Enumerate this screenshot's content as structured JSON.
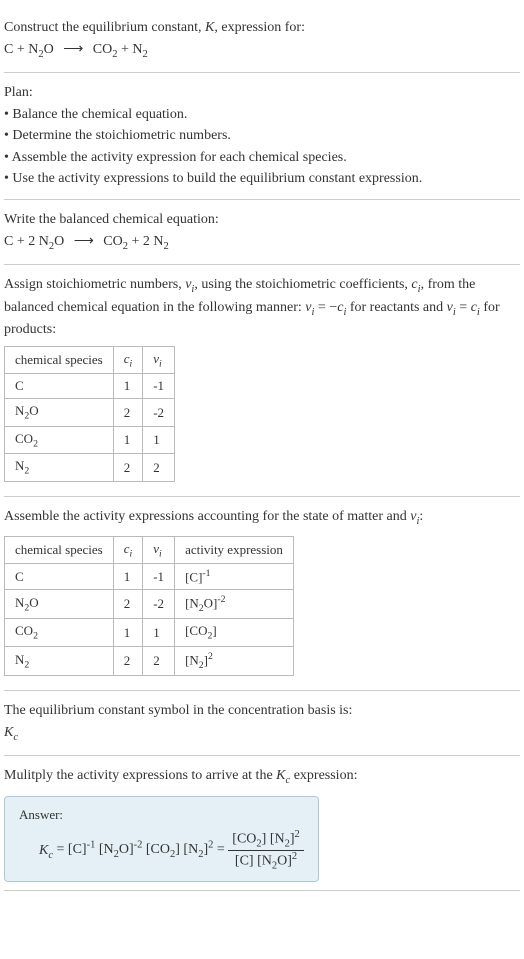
{
  "header": {
    "prompt": "Construct the equilibrium constant, K, expression for:",
    "equation_raw": "C + N₂O ⟶ CO₂ + N₂"
  },
  "plan": {
    "title": "Plan:",
    "items": [
      "Balance the chemical equation.",
      "Determine the stoichiometric numbers.",
      "Assemble the activity expression for each chemical species.",
      "Use the activity expressions to build the equilibrium constant expression."
    ]
  },
  "balanced": {
    "title": "Write the balanced chemical equation:",
    "equation_raw": "C + 2 N₂O ⟶ CO₂ + 2 N₂"
  },
  "stoich": {
    "text1": "Assign stoichiometric numbers, νᵢ, using the stoichiometric coefficients, cᵢ, from the balanced chemical equation in the following manner: νᵢ = −cᵢ for reactants and νᵢ = cᵢ for products:",
    "headers": [
      "chemical species",
      "cᵢ",
      "νᵢ"
    ],
    "rows": [
      {
        "species": "C",
        "c": "1",
        "v": "-1"
      },
      {
        "species": "N₂O",
        "c": "2",
        "v": "-2"
      },
      {
        "species": "CO₂",
        "c": "1",
        "v": "1"
      },
      {
        "species": "N₂",
        "c": "2",
        "v": "2"
      }
    ]
  },
  "activity": {
    "text": "Assemble the activity expressions accounting for the state of matter and νᵢ:",
    "headers": [
      "chemical species",
      "cᵢ",
      "νᵢ",
      "activity expression"
    ],
    "rows": [
      {
        "species": "C",
        "c": "1",
        "v": "-1",
        "expr": "[C]⁻¹"
      },
      {
        "species": "N₂O",
        "c": "2",
        "v": "-2",
        "expr": "[N₂O]⁻²"
      },
      {
        "species": "CO₂",
        "c": "1",
        "v": "1",
        "expr": "[CO₂]"
      },
      {
        "species": "N₂",
        "c": "2",
        "v": "2",
        "expr": "[N₂]²"
      }
    ]
  },
  "symbol": {
    "text": "The equilibrium constant symbol in the concentration basis is:",
    "sym": "K_c"
  },
  "result": {
    "text": "Mulitply the activity expressions to arrive at the K_c expression:",
    "answer_label": "Answer:"
  }
}
